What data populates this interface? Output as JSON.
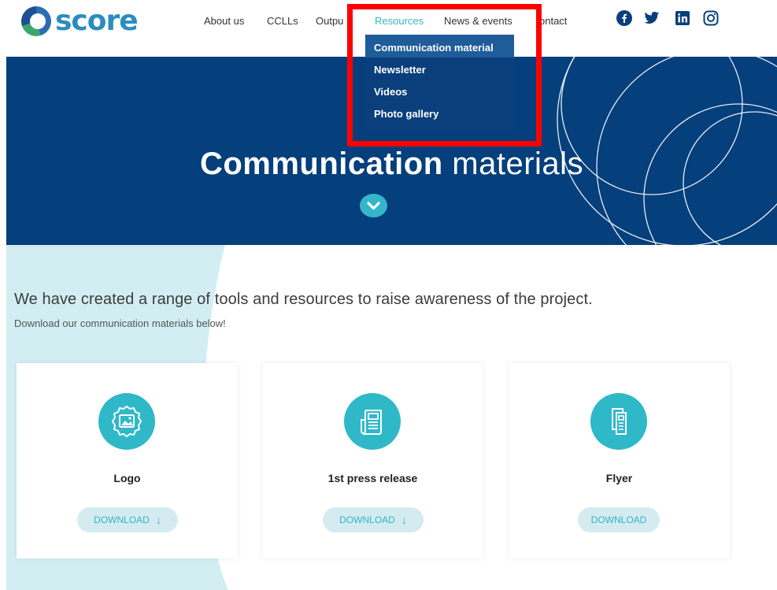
{
  "brand": {
    "name": "score"
  },
  "nav": {
    "about": "About us",
    "cclls": "CCLLs",
    "outputs": "Outpu",
    "resources": "Resources",
    "news": "News & events",
    "contact": "ontact"
  },
  "social_icons": [
    "facebook-icon",
    "twitter-icon",
    "linkedin-icon",
    "instagram-icon"
  ],
  "dropdown": {
    "items": [
      "Communication material",
      "Newsletter",
      "Videos",
      "Photo gallery"
    ],
    "active_index": 0
  },
  "hero": {
    "title_bold": "Communication",
    "title_light": "materials"
  },
  "intro": {
    "headline": "We have created a range of tools and resources to raise awareness of the project.",
    "subline": "Download our communication materials below!"
  },
  "cards": [
    {
      "title": "Logo",
      "button": "DOWNLOAD",
      "arrow": "↓",
      "icon": "image-badge-icon"
    },
    {
      "title": "1st press release",
      "button": "DOWNLOAD",
      "arrow": "↓",
      "icon": "newspaper-icon"
    },
    {
      "title": "Flyer",
      "button": "DOWNLOAD",
      "icon": "flyer-icon"
    }
  ],
  "colors": {
    "hero_bg": "#053f7c",
    "accent": "#34b6ca",
    "dropdown_bg": "#0b3f7c",
    "highlight": "#ff0000",
    "band": "#d2eef2"
  }
}
